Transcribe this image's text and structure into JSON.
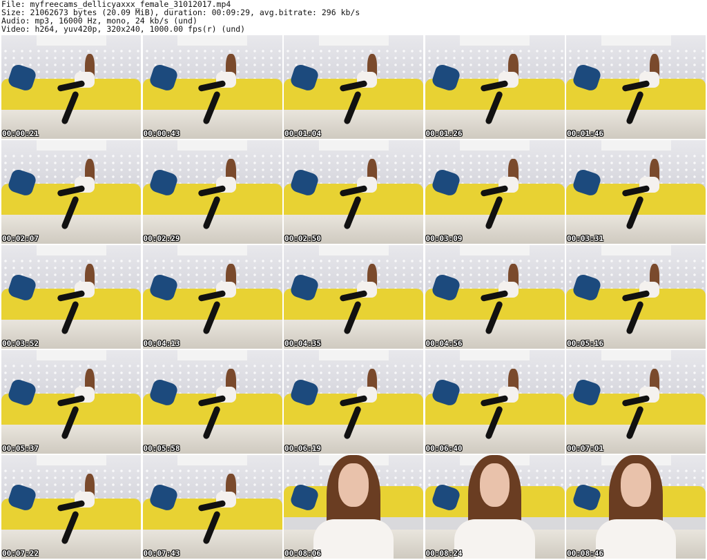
{
  "header": {
    "file": "File: myfreecams_dellicyaxxx_female_31012017.mp4",
    "size": "Size: 21062673 bytes (20.09 MiB), duration: 00:09:29, avg.bitrate: 296 kb/s",
    "audio": "Audio: mp3, 16000 Hz, mono, 24 kb/s (und)",
    "video": "Video: h264, yuv420p, 320x240, 1000.00 fps(r) (und)"
  },
  "thumbnails": [
    {
      "time": "00:00:21",
      "view": "wide"
    },
    {
      "time": "00:00:43",
      "view": "wide"
    },
    {
      "time": "00:01:04",
      "view": "wide"
    },
    {
      "time": "00:01:26",
      "view": "wide"
    },
    {
      "time": "00:01:46",
      "view": "wide"
    },
    {
      "time": "00:02:07",
      "view": "wide"
    },
    {
      "time": "00:02:29",
      "view": "wide"
    },
    {
      "time": "00:02:50",
      "view": "wide"
    },
    {
      "time": "00:03:09",
      "view": "wide"
    },
    {
      "time": "00:03:31",
      "view": "wide"
    },
    {
      "time": "00:03:52",
      "view": "wide"
    },
    {
      "time": "00:04:13",
      "view": "wide"
    },
    {
      "time": "00:04:35",
      "view": "wide"
    },
    {
      "time": "00:04:56",
      "view": "wide"
    },
    {
      "time": "00:05:16",
      "view": "wide"
    },
    {
      "time": "00:05:37",
      "view": "wide"
    },
    {
      "time": "00:05:58",
      "view": "wide"
    },
    {
      "time": "00:06:19",
      "view": "wide"
    },
    {
      "time": "00:06:40",
      "view": "wide"
    },
    {
      "time": "00:07:01",
      "view": "wide"
    },
    {
      "time": "00:07:22",
      "view": "wide"
    },
    {
      "time": "00:07:43",
      "view": "wide"
    },
    {
      "time": "00:08:06",
      "view": "close"
    },
    {
      "time": "00:08:24",
      "view": "close"
    },
    {
      "time": "00:08:46",
      "view": "close"
    }
  ]
}
